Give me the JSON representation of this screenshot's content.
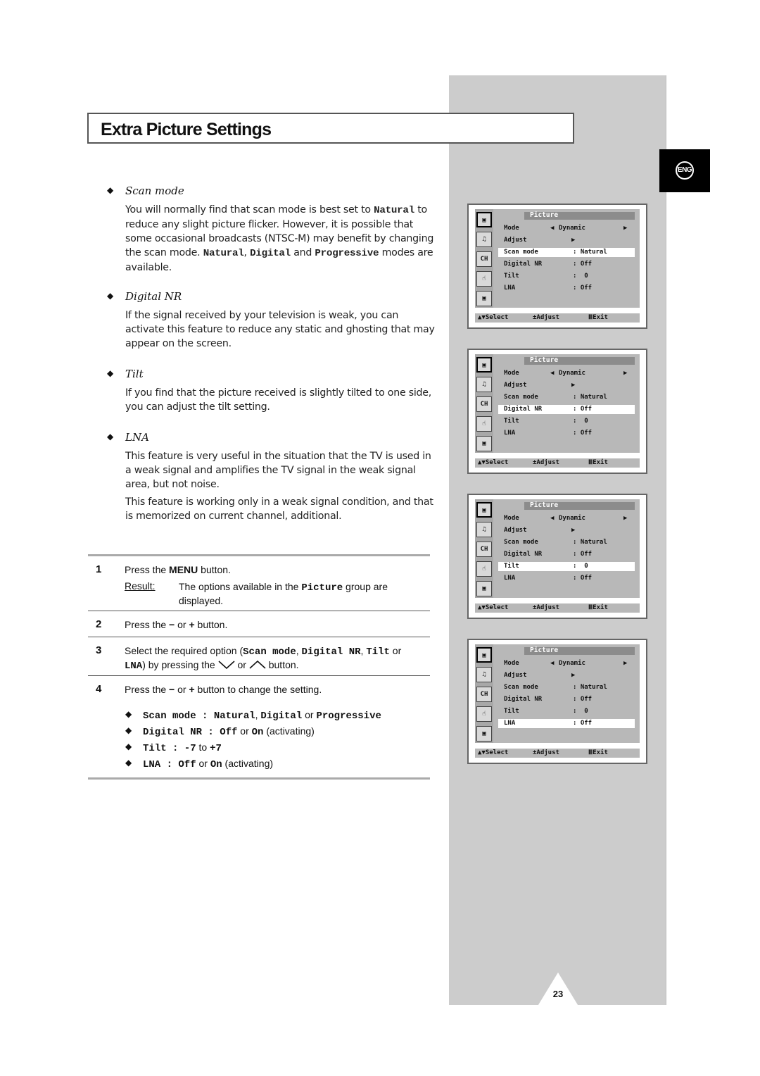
{
  "page": {
    "title": "Extra Picture Settings",
    "language_badge": "ENG",
    "page_number": "23"
  },
  "sections": [
    {
      "heading": "Scan mode",
      "paragraphs": [
        [
          {
            "t": "You will normally find that scan mode is best set to "
          },
          {
            "t": "Natural",
            "mono": true
          },
          {
            "t": " to reduce any slight picture flicker. However, it is possible that some occasional broadcasts (NTSC-M) may benefit by changing the scan mode. "
          },
          {
            "t": "Natural",
            "mono": true
          },
          {
            "t": ", "
          },
          {
            "t": "Digital",
            "mono": true
          },
          {
            "t": " and "
          },
          {
            "t": "Progressive",
            "mono": true
          },
          {
            "t": " modes are available."
          }
        ]
      ]
    },
    {
      "heading": "Digital NR",
      "paragraphs": [
        [
          {
            "t": "If the signal received by your television is weak, you can activate this feature to reduce any static and ghosting that may appear on the screen."
          }
        ]
      ]
    },
    {
      "heading": "Tilt",
      "paragraphs": [
        [
          {
            "t": "If you find that the picture received is slightly tilted to one side, you can adjust the tilt setting."
          }
        ]
      ]
    },
    {
      "heading": "LNA",
      "paragraphs": [
        [
          {
            "t": "This feature is very useful in the situation that the TV is used in a weak signal and amplifies the TV signal in the weak signal area, but not noise."
          }
        ],
        [
          {
            "t": "This feature is working only in a weak signal condition, and that is memorized on current channel, additional."
          }
        ]
      ]
    }
  ],
  "steps": [
    {
      "number": "1",
      "text": [
        {
          "t": "Press the "
        },
        {
          "t": "MENU",
          "bold": true
        },
        {
          "t": " button."
        }
      ],
      "result_label": "Result:",
      "result_text": [
        {
          "t": "The options available in the "
        },
        {
          "t": "Picture",
          "mono": true
        },
        {
          "t": " group are displayed."
        }
      ]
    },
    {
      "number": "2",
      "text": [
        {
          "t": "Press the "
        },
        {
          "t": "−",
          "bold": true
        },
        {
          "t": " or "
        },
        {
          "t": "+",
          "bold": true
        },
        {
          "t": " button."
        }
      ]
    },
    {
      "number": "3",
      "text": [
        {
          "t": "Select the required option ("
        },
        {
          "t": "Scan mode",
          "mono": true
        },
        {
          "t": ", "
        },
        {
          "t": "Digital NR",
          "mono": true
        },
        {
          "t": ", "
        },
        {
          "t": "Tilt",
          "mono": true
        },
        {
          "t": " or "
        },
        {
          "t": "LNA",
          "mono": true
        },
        {
          "t": ") by pressing the "
        },
        {
          "icon": "down"
        },
        {
          "t": " or "
        },
        {
          "icon": "up"
        },
        {
          "t": " button."
        }
      ]
    },
    {
      "number": "4",
      "text": [
        {
          "t": "Press the "
        },
        {
          "t": "−",
          "bold": true
        },
        {
          "t": " or "
        },
        {
          "t": "+",
          "bold": true
        },
        {
          "t": " button to change the setting."
        }
      ],
      "options": [
        [
          {
            "t": "Scan mode : Natural",
            "mono": true
          },
          {
            "t": ", "
          },
          {
            "t": "Digital",
            "mono": true
          },
          {
            "t": " or "
          },
          {
            "t": "Progressive",
            "mono": true
          }
        ],
        [
          {
            "t": "Digital NR : Off",
            "mono": true
          },
          {
            "t": " or "
          },
          {
            "t": "On",
            "mono": true
          },
          {
            "t": " (activating)"
          }
        ],
        [
          {
            "t": "Tilt : -7",
            "mono": true
          },
          {
            "t": " to "
          },
          {
            "t": "+7",
            "mono": true
          }
        ],
        [
          {
            "t": "LNA : Off",
            "mono": true
          },
          {
            "t": " or "
          },
          {
            "t": "On",
            "mono": true
          },
          {
            "t": " (activating)"
          }
        ]
      ]
    }
  ],
  "osd": {
    "header": "Picture",
    "side_icons": [
      "picture-icon",
      "sound-icon",
      "channel-icon",
      "setup-icon",
      "input-icon"
    ],
    "channel_icon_label": "CH",
    "rows": [
      {
        "key": "Mode",
        "value": "Dynamic",
        "arrows": true
      },
      {
        "key": "Adjust",
        "value": "▶"
      },
      {
        "key": "Scan mode",
        "value": ": Natural"
      },
      {
        "key": "Digital NR",
        "value": ": Off"
      },
      {
        "key": "Tilt",
        "value": ":  0"
      },
      {
        "key": "LNA",
        "value": ": Off"
      }
    ],
    "footer": {
      "select": "▲▼Select",
      "adjust": "±Adjust",
      "exit": "ⅢExit"
    },
    "screens": [
      {
        "highlighted_row": 2
      },
      {
        "highlighted_row": 3
      },
      {
        "highlighted_row": 4
      },
      {
        "highlighted_row": 5
      }
    ]
  }
}
